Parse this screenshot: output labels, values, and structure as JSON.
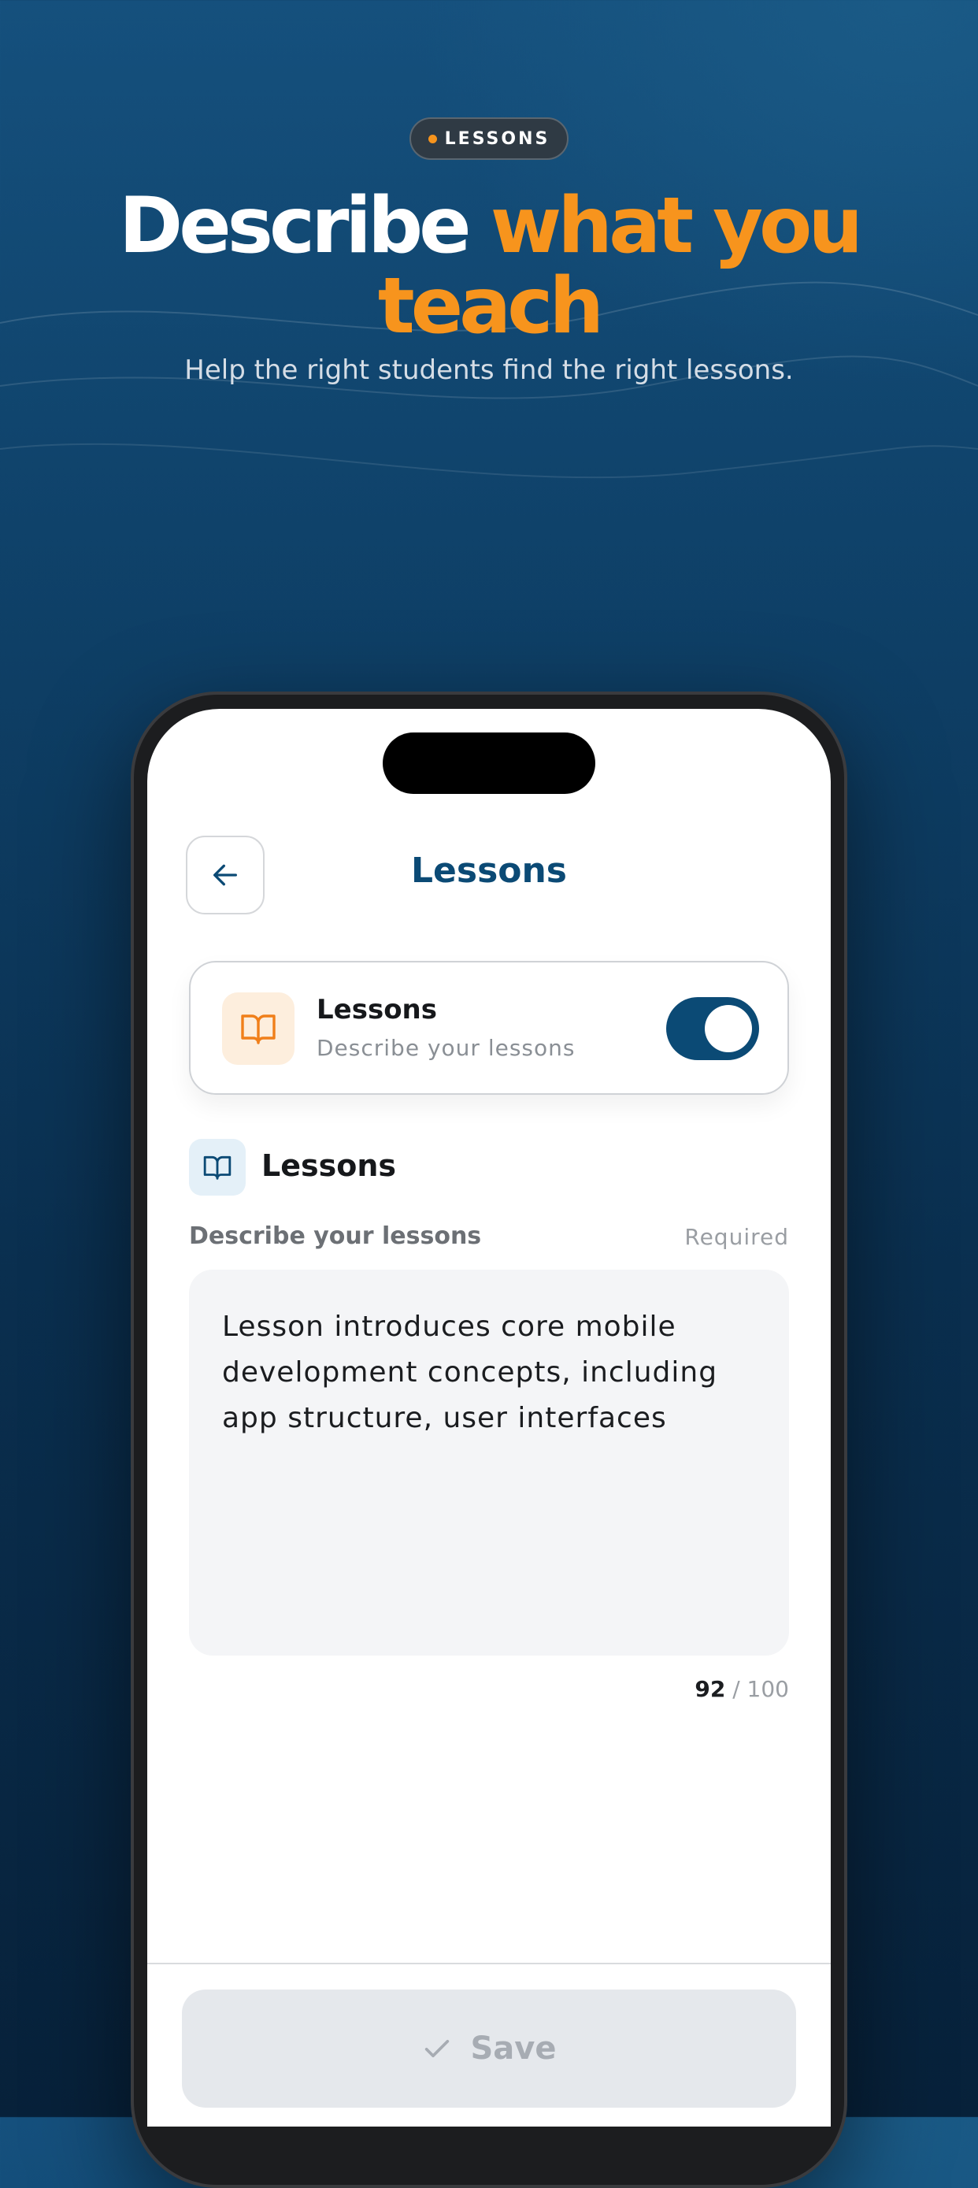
{
  "badge": {
    "label": "LESSONS"
  },
  "hero": {
    "title_part1": "Describe ",
    "title_part2": "what you teach",
    "subtitle": "Help the right students find the right lessons."
  },
  "nav": {
    "title": "Lessons"
  },
  "toggle_card": {
    "title": "Lessons",
    "subtitle": "Describe your lessons",
    "enabled": true
  },
  "section": {
    "title": "Lessons",
    "field_label": "Describe your lessons",
    "field_required": "Required",
    "field_value": "Lesson introduces core mobile development concepts, including app structure, user interfaces",
    "count_current": "92",
    "count_separator": " / ",
    "count_max": "100"
  },
  "footer": {
    "save_label": "Save"
  },
  "colors": {
    "accent_orange": "#f7941d",
    "brand_blue": "#0b4a75",
    "background_dark": "#0a2f4f"
  },
  "icons": {
    "back": "arrow-left-icon",
    "card": "open-book-icon",
    "section": "open-book-icon",
    "save": "check-icon"
  }
}
